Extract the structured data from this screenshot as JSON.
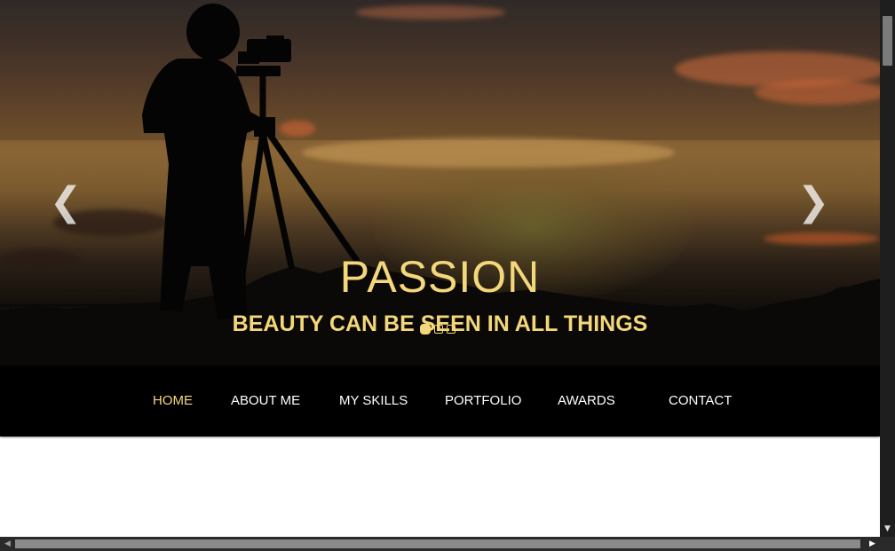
{
  "hero": {
    "title": "PASSION",
    "subtitle": "BEAUTY CAN BE SEEN IN ALL THINGS",
    "prev_icon": "❮",
    "next_icon": "❯",
    "slide_count": 3,
    "active_slide": 1
  },
  "nav": {
    "items": [
      {
        "label": "HOME",
        "active": true
      },
      {
        "label": "ABOUT ME",
        "active": false
      },
      {
        "label": "MY SKILLS",
        "active": false
      },
      {
        "label": "PORTFOLIO",
        "active": false
      },
      {
        "label": "AWARDS",
        "active": false
      },
      {
        "label": "CONTACT",
        "active": false
      }
    ]
  },
  "scrollbars": {
    "down_icon": "▼",
    "left_icon": "◀",
    "right_icon": "▶"
  },
  "colors": {
    "accent": "#f3d77a",
    "nav_bg": "#000000",
    "nav_text": "#ffffff",
    "page_bg": "#ffffff"
  }
}
